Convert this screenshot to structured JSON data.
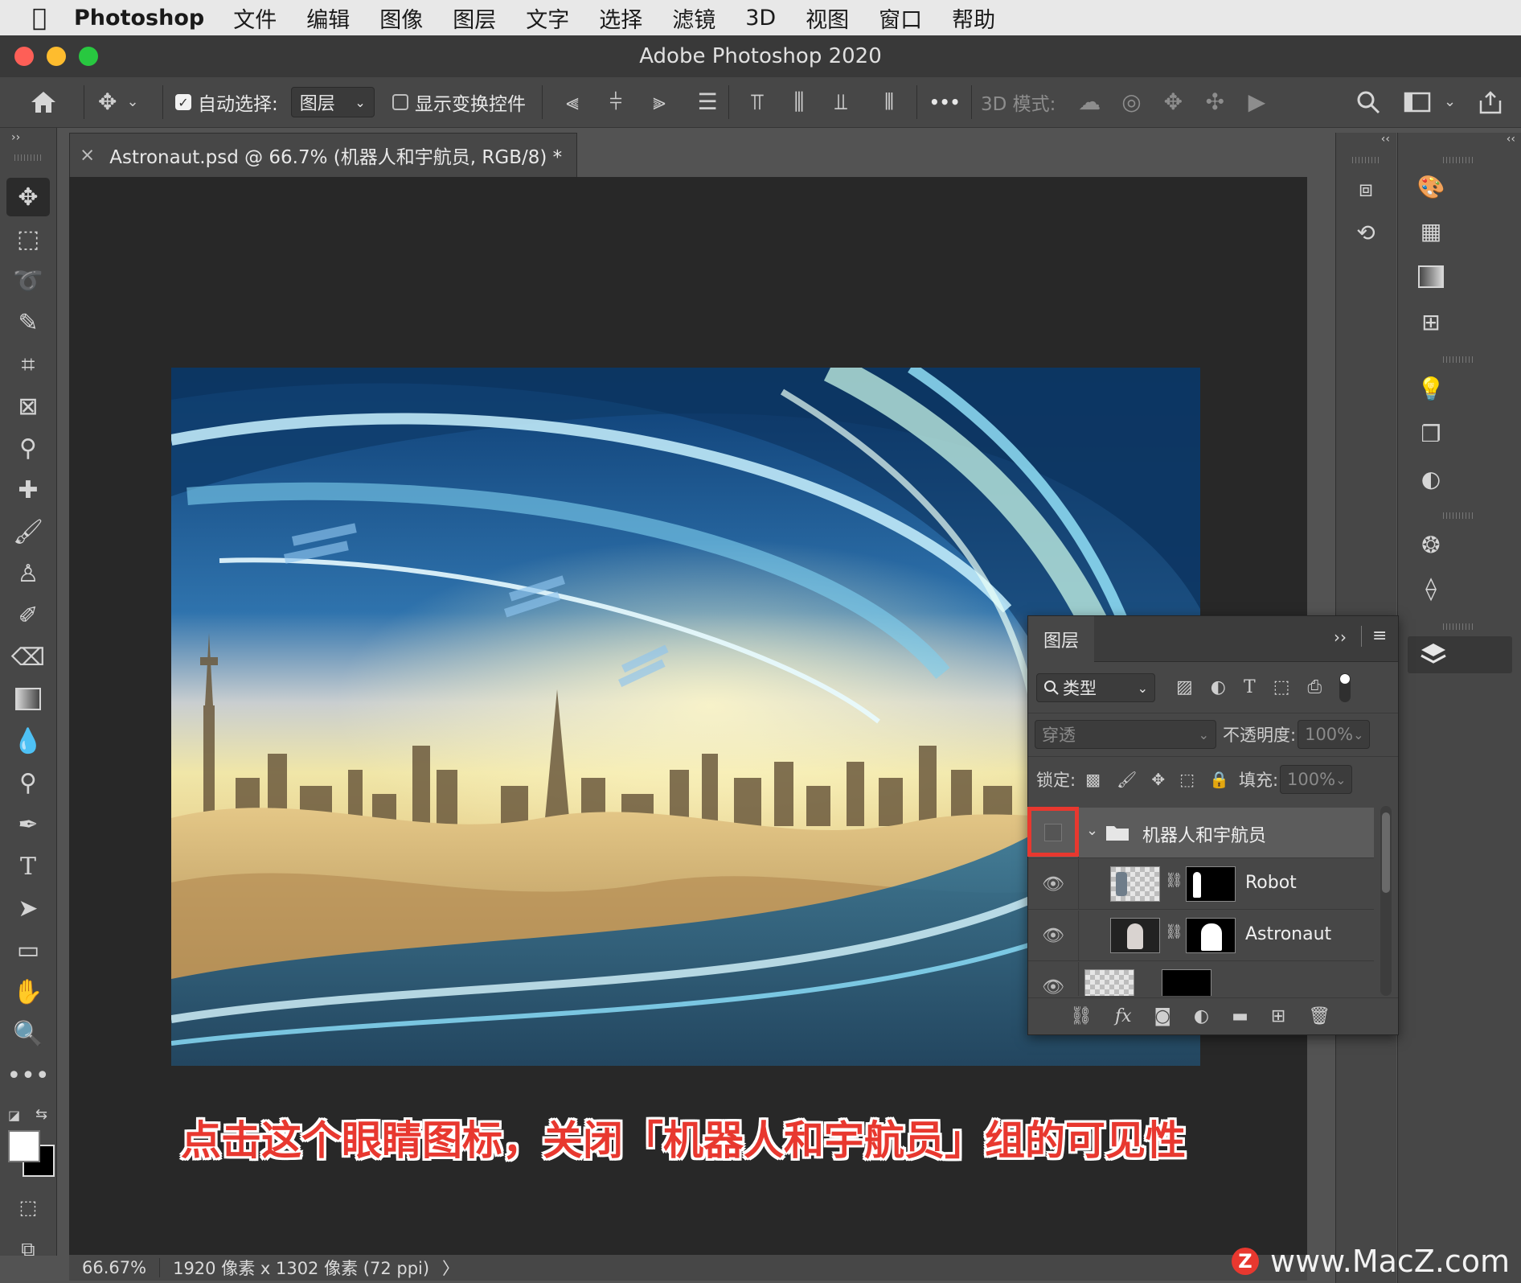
{
  "menubar": {
    "app_name": "Photoshop",
    "items": [
      "文件",
      "编辑",
      "图像",
      "图层",
      "文字",
      "选择",
      "滤镜",
      "3D",
      "视图",
      "窗口",
      "帮助"
    ]
  },
  "window": {
    "title": "Adobe Photoshop 2020"
  },
  "options": {
    "auto_select_label": "自动选择:",
    "auto_select_checked": true,
    "auto_select_value": "图层",
    "show_transform_label": "显示变换控件",
    "show_transform_checked": false,
    "more": "•••",
    "mode_3d_label": "3D 模式:"
  },
  "document": {
    "tab_title": "Astronaut.psd @ 66.7% (机器人和宇航员, RGB/8) *",
    "close_glyph": "×"
  },
  "status": {
    "zoom": "66.67%",
    "dimensions": "1920 像素 x 1302 像素 (72 ppi)",
    "chevron": "〉"
  },
  "layers_panel": {
    "tab": "图层",
    "filter_label": "类型",
    "blend_mode": "穿透",
    "opacity_label": "不透明度:",
    "opacity_value": "100%",
    "lock_label": "锁定:",
    "fill_label": "填充:",
    "fill_value": "100%",
    "layers": [
      {
        "name": "机器人和宇航员",
        "type": "group",
        "visible": false,
        "expanded": true
      },
      {
        "name": "Robot",
        "type": "layer",
        "visible": true
      },
      {
        "name": "Astronaut",
        "type": "layer",
        "visible": true
      },
      {
        "name": "",
        "type": "layer",
        "visible": true
      }
    ]
  },
  "caption": "点击这个眼睛图标，关闭「机器人和宇航员」组的可见性",
  "watermark": {
    "badge": "Z",
    "text": "www.MacZ.com"
  },
  "colors": {
    "annotation_red": "#e8382f",
    "canvas_bg": "#282828",
    "panel_bg": "#474747"
  }
}
